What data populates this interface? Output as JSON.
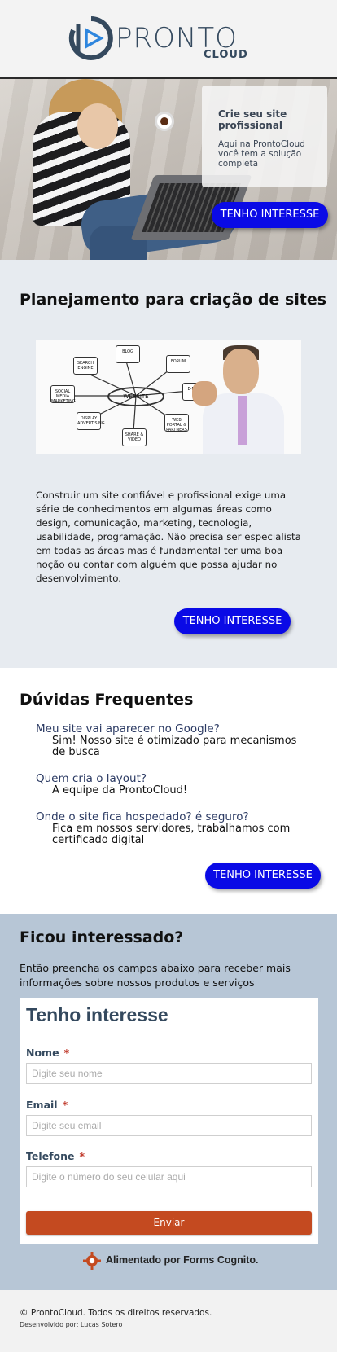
{
  "header": {
    "brand": "PRONTO",
    "brand_sub": "CLOUD"
  },
  "hero": {
    "card_title": "Crie seu site profissional",
    "card_text": "Aqui na ProntoCloud você tem a solução completa",
    "cta_label": "TENHO INTERESSE"
  },
  "plan": {
    "title": "Planejamento para criação de sites",
    "diagram": {
      "hub": "WEBSITE",
      "nodes": [
        "SEARCH ENGINE",
        "BLOG",
        "FORUM",
        "SOCIAL MEDIA MARKETING",
        "DISPLAY ADVERTISING",
        "SHARE & VIDEO",
        "WEB PORTAL & PARTNERS",
        "E-MAIL"
      ]
    },
    "body": "Construir um site confiável e profissional exige uma série de conhecimentos em algumas áreas como design, comunicação, marketing, tecnologia, usabilidade, programação. Não precisa ser especialista em todas as áreas mas é fundamental ter uma boa noção ou contar com alguém que possa ajudar no desenvolvimento.",
    "cta_label": "TENHO INTERESSE"
  },
  "faq": {
    "title": "Dúvidas Frequentes",
    "items": [
      {
        "q": "Meu site vai aparecer no Google?",
        "a": "Sim! Nosso site é otimizado para mecanismos de busca"
      },
      {
        "q": "Quem cria o layout?",
        "a": "A equipe da ProntoCloud!"
      },
      {
        "q": "Onde o site fica hospedado? é seguro?",
        "a": "Fica em nossos servidores, trabalhamos com certificado digital"
      }
    ],
    "cta_label": "TENHO INTERESSE"
  },
  "interest": {
    "title": "Ficou interessado?",
    "intro": "Então preencha os campos abaixo para receber mais informações sobre nossos produtos e serviços",
    "form": {
      "title": "Tenho interesse",
      "name_label": "Nome",
      "name_placeholder": "Digite seu nome",
      "email_label": "Email",
      "email_placeholder": "Digite seu email",
      "phone_label": "Telefone",
      "phone_placeholder": "Digite o número do seu celular aqui",
      "required_mark": "*",
      "submit_label": "Enviar"
    },
    "powered_by": "Alimentado por Forms Cognito."
  },
  "footer": {
    "copyright": "© ProntoCloud. Todos os direitos reservados.",
    "developer": "Desenvolvido por: Lucas Sotero"
  },
  "colors": {
    "cta": "#0a0ae6",
    "submit": "#c44a20",
    "plan_bg": "#e7ebf0",
    "interest_bg": "#b7c6d6",
    "brand": "#34495e"
  }
}
